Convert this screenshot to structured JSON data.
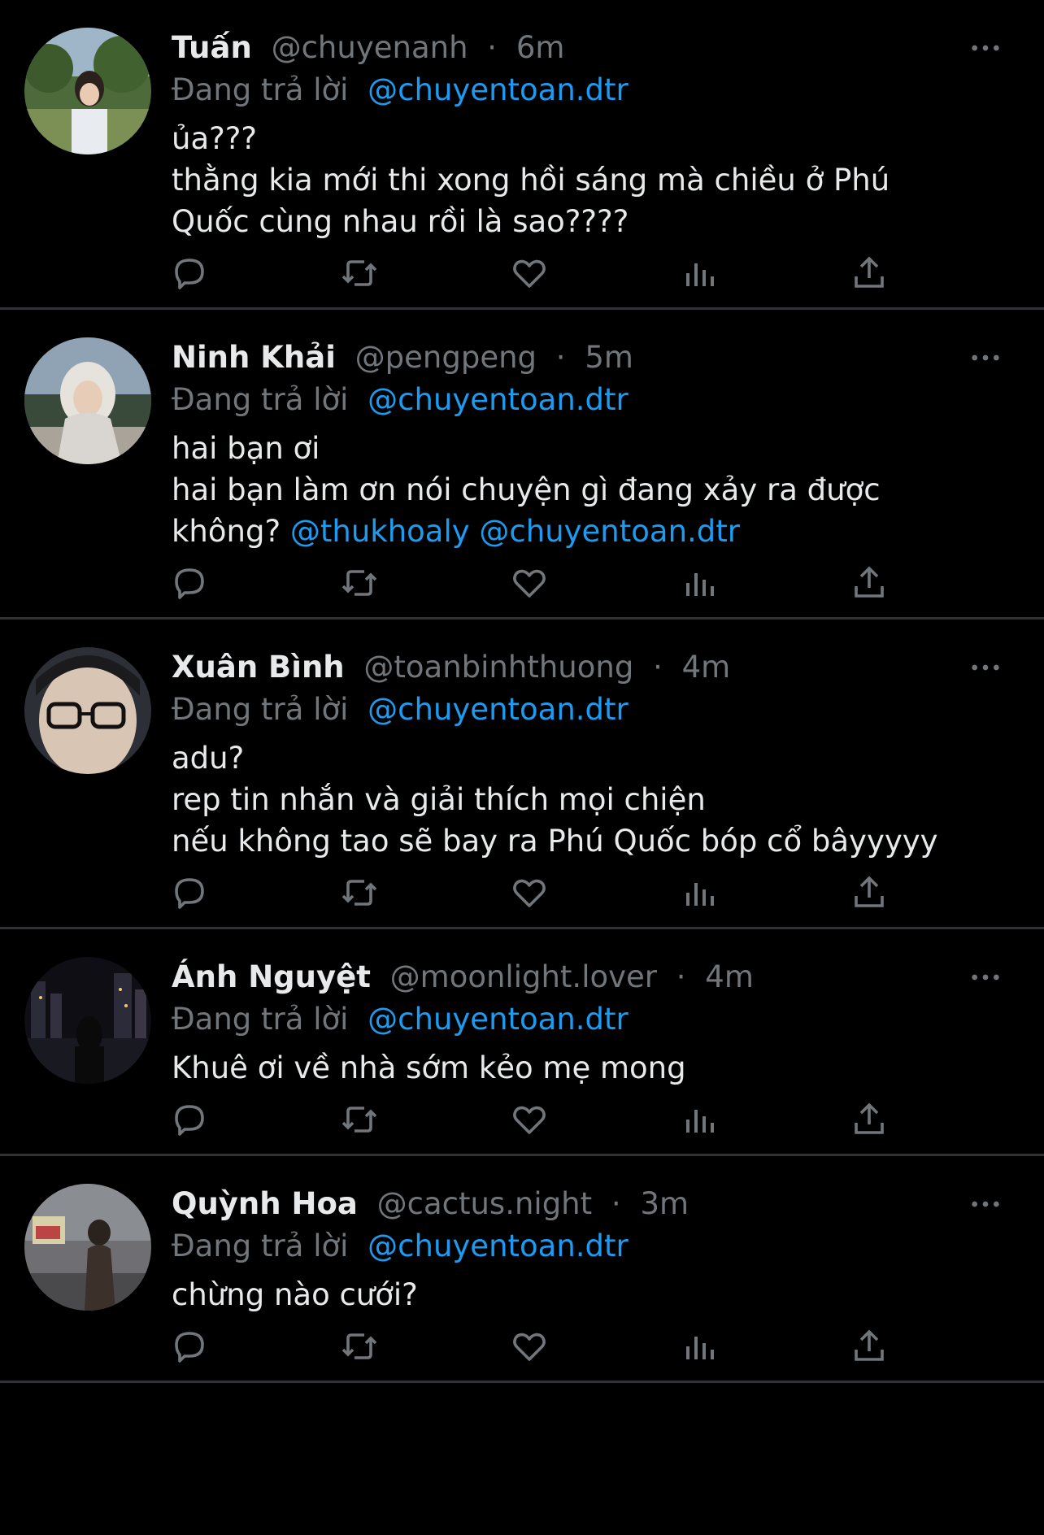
{
  "colors": {
    "background": "#000000",
    "text": "#E7E9EA",
    "muted": "#71767B",
    "link": "#1D9BF0",
    "divider": "#2F3336"
  },
  "reply_prefix": "Đang trả lời",
  "tweets": [
    {
      "name": "Tuấn",
      "handle": "@chuyenanh",
      "dot": "·",
      "time": "6m",
      "reply_to": "@chuyentoan.dtr",
      "lines": [
        [
          {
            "text": "ủa???"
          }
        ],
        [
          {
            "text": "thằng kia mới thi xong hồi sáng mà chiều ở Phú"
          }
        ],
        [
          {
            "text": "Quốc cùng nhau rồi là sao????"
          }
        ]
      ],
      "avatar": "photo"
    },
    {
      "name": "Ninh Khải",
      "handle": "@pengpeng",
      "dot": "·",
      "time": "5m",
      "reply_to": "@chuyentoan.dtr",
      "lines": [
        [
          {
            "text": "hai bạn ơi"
          }
        ],
        [
          {
            "text": "hai bạn làm ơn nói chuyện gì đang xảy ra được"
          }
        ],
        [
          {
            "text": "không? "
          },
          {
            "text": "@thukhoaly",
            "mention": true
          },
          {
            "text": " "
          },
          {
            "text": "@chuyentoan.dtr",
            "mention": true
          }
        ]
      ],
      "avatar": "photo"
    },
    {
      "name": "Xuân Bình",
      "handle": "@toanbinhthuong",
      "dot": "·",
      "time": "4m",
      "reply_to": "@chuyentoan.dtr",
      "lines": [
        [
          {
            "text": "adu?"
          }
        ],
        [
          {
            "text": "rep tin nhắn và giải thích mọi chiện"
          }
        ],
        [
          {
            "text": "nếu không tao sẽ bay ra Phú Quốc bóp cổ bâyyyyy"
          }
        ]
      ],
      "avatar": "photo"
    },
    {
      "name": "Ánh Nguyệt",
      "handle": "@moonlight.lover",
      "dot": "·",
      "time": "4m",
      "reply_to": "@chuyentoan.dtr",
      "lines": [
        [
          {
            "text": "Khuê ơi về nhà sớm kẻo mẹ mong"
          }
        ]
      ],
      "avatar": "photo"
    },
    {
      "name": "Quỳnh Hoa",
      "handle": "@cactus.night",
      "dot": "·",
      "time": "3m",
      "reply_to": "@chuyentoan.dtr",
      "lines": [
        [
          {
            "text": "chừng nào cưới?"
          }
        ]
      ],
      "avatar": "photo"
    }
  ],
  "icons": {
    "more": "more-horizontal-icon",
    "reply": "reply-bubble-icon",
    "retweet": "retweet-icon",
    "like": "heart-icon",
    "views": "bar-chart-icon",
    "share": "share-upload-icon"
  }
}
